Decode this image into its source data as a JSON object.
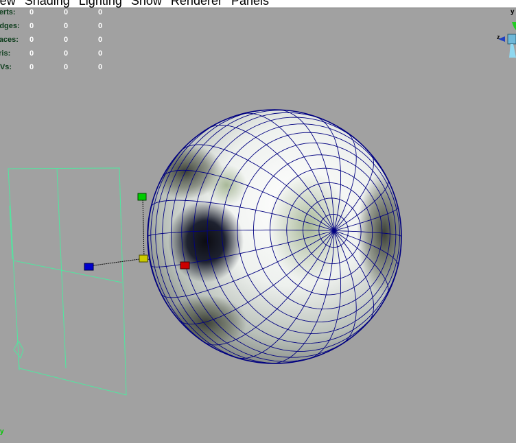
{
  "menu": {
    "items": [
      "View",
      "Shading",
      "Lighting",
      "Show",
      "Renderer",
      "Panels"
    ]
  },
  "hud": {
    "rows": [
      {
        "label": "Verts:",
        "values": [
          "0",
          "0",
          "0"
        ]
      },
      {
        "label": "Edges:",
        "values": [
          "0",
          "0",
          "0"
        ]
      },
      {
        "label": "Faces:",
        "values": [
          "0",
          "0",
          "0"
        ]
      },
      {
        "label": "Tris:",
        "values": [
          "0",
          "0",
          "0"
        ]
      },
      {
        "label": "UVs:",
        "values": [
          "0",
          "0",
          "0"
        ]
      }
    ]
  },
  "view_cube": {
    "up_axis_label": "y",
    "side_axis_label": "z"
  },
  "axis_indicator": {
    "label": "y"
  },
  "colors": {
    "viewport_bg": "#a1a1a1",
    "wireframe": "#000080",
    "camera_frustum": "#4fe8a0",
    "hud_label": "#0d3d1c",
    "hud_value": "#ffffff",
    "manip_x": "#cc0000",
    "manip_y": "#00cc00",
    "manip_z": "#0000cc",
    "manip_center": "#cccc00"
  }
}
